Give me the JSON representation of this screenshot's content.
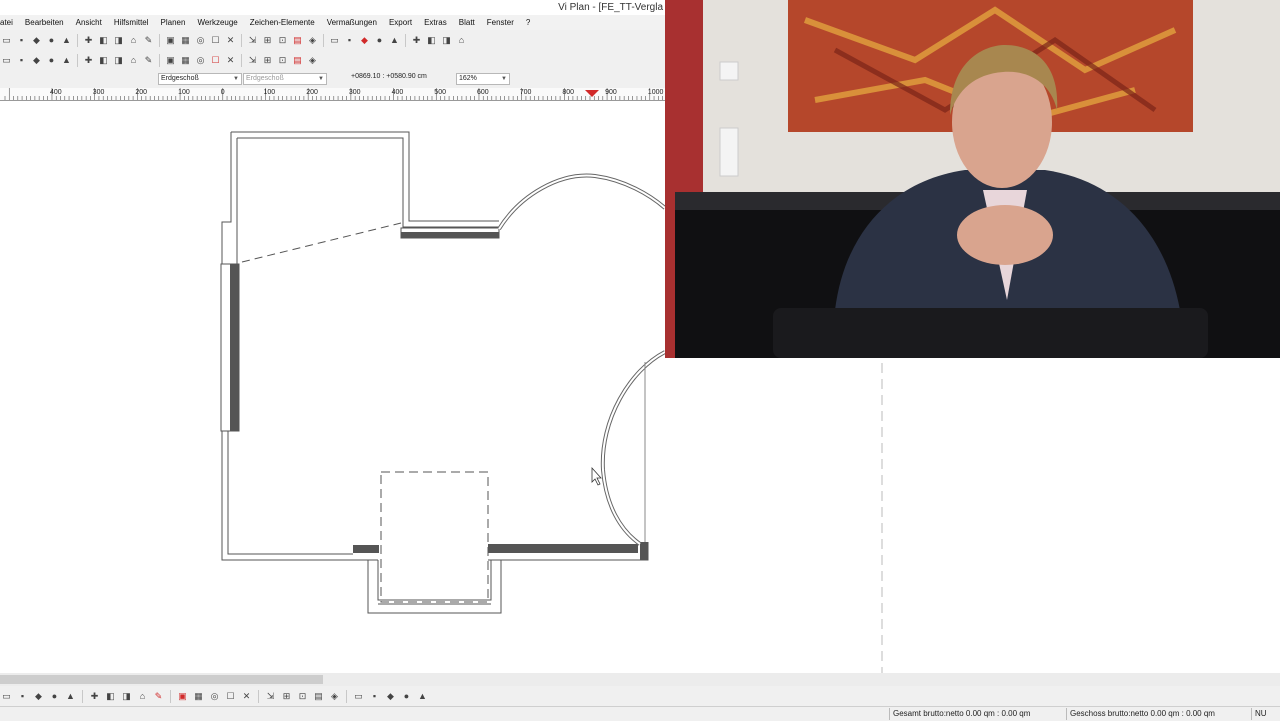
{
  "window": {
    "title": "Vi Plan - [FE_TT-Vergla"
  },
  "menubar": {
    "items": [
      "atei",
      "Bearbeiten",
      "Ansicht",
      "Hilfsmittel",
      "Planen",
      "Werkzeuge",
      "Zeichen-Elemente",
      "Vermaßungen",
      "Export",
      "Extras",
      "Blatt",
      "Fenster",
      "?"
    ]
  },
  "options": {
    "floor_select": "Erdgeschoß",
    "floor_select_2": "Erdgeschoß",
    "coordinates": "+0869.10 : +0580.90 cm",
    "zoom": "162%"
  },
  "ruler": {
    "labels": [
      "400",
      "300",
      "200",
      "100",
      "0",
      "100",
      "200",
      "300",
      "400",
      "500",
      "600",
      "700",
      "800",
      "900",
      "1000"
    ]
  },
  "status": {
    "total": "Gesamt brutto:netto 0.00 qm : 0.00 qm",
    "floor": "Geschoss brutto:netto 0.00 qm : 0.00 qm",
    "mode": "NU"
  },
  "icons": {
    "toolbar_row1": [
      "open-icon",
      "save-icon",
      "print-icon",
      "copy-icon",
      "paste-icon",
      "info-icon",
      "page-icon",
      "zoom-fit-icon",
      "zoom-icon",
      "hand-icon",
      "select-icon",
      "snap-icon",
      "grid-icon",
      "measure-icon",
      "wall-icon",
      "window-icon",
      "door-icon",
      "room-icon",
      "delete-icon",
      "arrow-icon",
      "house-icon",
      "check-icon",
      "cross-icon",
      "tool-icon",
      "euro-icon",
      "pen-icon",
      "brush-icon",
      "flag-icon",
      "table-icon"
    ],
    "toolbar_row2": [
      "layer-icon",
      "home-icon",
      "list-icon",
      "stairs-icon",
      "column-icon",
      "beam-icon",
      "text-icon",
      "hatch-icon",
      "fill-icon",
      "symbol-icon",
      "roof-icon",
      "render-icon",
      "export-icon",
      "pdf-icon",
      "image-icon",
      "label-icon",
      "shape-icon",
      "color-icon",
      "heart-icon",
      "cloud-icon"
    ],
    "bottom_toolbar": [
      "tool-1-icon",
      "tool-2-icon",
      "tool-3-icon",
      "tool-4-icon",
      "undo-icon",
      "scissors-icon",
      "line-icon",
      "rotate-icon",
      "mirror-icon",
      "cross-icon",
      "delete-icon",
      "list-icon",
      "line-draw-icon",
      "circle-icon",
      "ellipse-icon",
      "text-a-icon",
      "brush-icon",
      "hand-icon",
      "measure-icon",
      "angle-icon",
      "dim-icon",
      "fill-icon",
      "gear-icon",
      "record-icon",
      "sphere-icon"
    ]
  },
  "colors": {
    "wall": "#555555",
    "accent_red": "#d12a2a"
  }
}
